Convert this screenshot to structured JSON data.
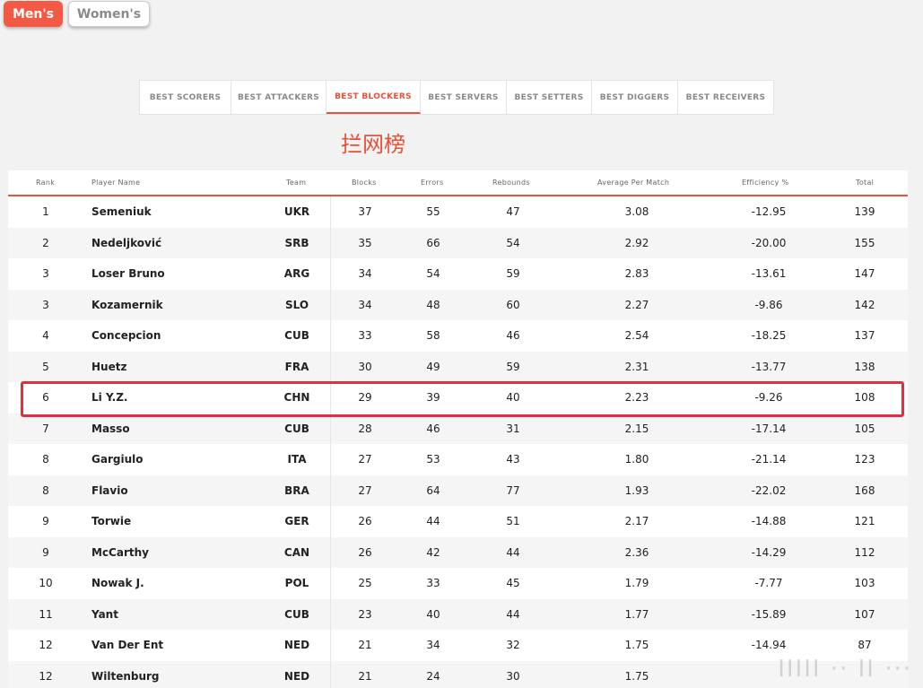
{
  "gender_tabs": [
    {
      "label": "Men's",
      "active": true
    },
    {
      "label": "Women's",
      "active": false
    }
  ],
  "category_tabs": [
    {
      "label": "BEST SCORERS",
      "active": false
    },
    {
      "label": "BEST ATTACKERS",
      "active": false
    },
    {
      "label": "BEST BLOCKERS",
      "active": true
    },
    {
      "label": "BEST SERVERS",
      "active": false
    },
    {
      "label": "BEST SETTERS",
      "active": false
    },
    {
      "label": "BEST DIGGERS",
      "active": false
    },
    {
      "label": "BEST RECEIVERS",
      "active": false
    }
  ],
  "section_title": "拦网榜",
  "table": {
    "columns": [
      "Rank",
      "Player Name",
      "Team",
      "Blocks",
      "Errors",
      "Rebounds",
      "Average Per Match",
      "Efficiency %",
      "Total"
    ],
    "rows": [
      [
        "1",
        "Semeniuk",
        "UKR",
        "37",
        "55",
        "47",
        "3.08",
        "-12.95",
        "139"
      ],
      [
        "2",
        "Nedeljković",
        "SRB",
        "35",
        "66",
        "54",
        "2.92",
        "-20.00",
        "155"
      ],
      [
        "3",
        "Loser Bruno",
        "ARG",
        "34",
        "54",
        "59",
        "2.83",
        "-13.61",
        "147"
      ],
      [
        "3",
        "Kozamernik",
        "SLO",
        "34",
        "48",
        "60",
        "2.27",
        "-9.86",
        "142"
      ],
      [
        "4",
        "Concepcion",
        "CUB",
        "33",
        "58",
        "46",
        "2.54",
        "-18.25",
        "137"
      ],
      [
        "5",
        "Huetz",
        "FRA",
        "30",
        "49",
        "59",
        "2.31",
        "-13.77",
        "138"
      ],
      [
        "6",
        "Li Y.Z.",
        "CHN",
        "29",
        "39",
        "40",
        "2.23",
        "-9.26",
        "108"
      ],
      [
        "7",
        "Masso",
        "CUB",
        "28",
        "46",
        "31",
        "2.15",
        "-17.14",
        "105"
      ],
      [
        "8",
        "Gargiulo",
        "ITA",
        "27",
        "53",
        "43",
        "1.80",
        "-21.14",
        "123"
      ],
      [
        "8",
        "Flavio",
        "BRA",
        "27",
        "64",
        "77",
        "1.93",
        "-22.02",
        "168"
      ],
      [
        "9",
        "Torwie",
        "GER",
        "26",
        "44",
        "51",
        "2.17",
        "-14.88",
        "121"
      ],
      [
        "9",
        "McCarthy",
        "CAN",
        "26",
        "42",
        "44",
        "2.36",
        "-14.29",
        "112"
      ],
      [
        "10",
        "Nowak J.",
        "POL",
        "25",
        "33",
        "45",
        "1.79",
        "-7.77",
        "103"
      ],
      [
        "11",
        "Yant",
        "CUB",
        "23",
        "40",
        "44",
        "1.77",
        "-15.89",
        "107"
      ],
      [
        "12",
        "Van Der Ent",
        "NED",
        "21",
        "34",
        "32",
        "1.75",
        "-14.94",
        "87"
      ],
      [
        "12",
        "Wiltenburg",
        "NED",
        "21",
        "24",
        "30",
        "1.75",
        "",
        ""
      ]
    ],
    "highlighted_row": 6
  },
  "colors": {
    "accent": "#e8513a",
    "active_button": "#f25a45",
    "highlight_box": "#e0303f"
  }
}
